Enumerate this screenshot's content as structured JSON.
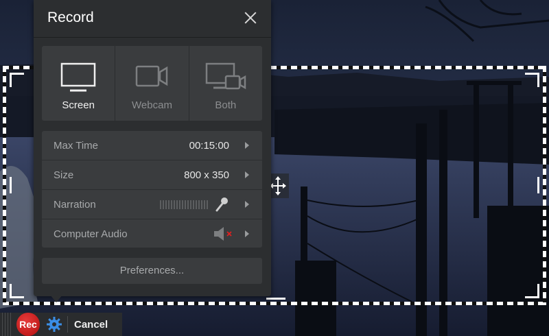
{
  "panel": {
    "title": "Record",
    "sources": [
      {
        "label": "Screen",
        "selected": true
      },
      {
        "label": "Webcam",
        "selected": false
      },
      {
        "label": "Both",
        "selected": false
      }
    ],
    "settings": {
      "max_time": {
        "label": "Max Time",
        "value": "00:15:00"
      },
      "size": {
        "label": "Size",
        "value": "800 x 350"
      },
      "narration": {
        "label": "Narration",
        "icon": "microphone-icon"
      },
      "computer_audio": {
        "label": "Computer Audio",
        "icon": "speaker-muted-icon"
      }
    },
    "preferences_label": "Preferences..."
  },
  "toolbar": {
    "rec_label": "Rec",
    "cancel_label": "Cancel"
  },
  "colors": {
    "panel_bg": "#2c2e30",
    "rec_red": "#c91414",
    "gear_blue": "#3a8ee6",
    "mute_red": "#e02020"
  }
}
